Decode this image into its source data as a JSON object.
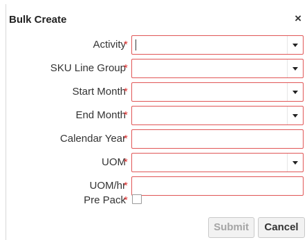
{
  "dialog": {
    "title": "Bulk Create",
    "close_label": "×"
  },
  "form": {
    "required_marker": "*",
    "fields": [
      {
        "label": "Activity",
        "type": "select",
        "value": ""
      },
      {
        "label": "SKU Line Group",
        "type": "select",
        "value": ""
      },
      {
        "label": "Start Month",
        "type": "select",
        "value": ""
      },
      {
        "label": "End Month",
        "type": "select",
        "value": ""
      },
      {
        "label": "Calendar Year",
        "type": "text",
        "value": ""
      },
      {
        "label": "UOM",
        "type": "select",
        "value": ""
      },
      {
        "label": "UOM/hr",
        "type": "text",
        "value": ""
      },
      {
        "label": "Pre Pack",
        "type": "checkbox",
        "checked": false
      }
    ]
  },
  "buttons": {
    "submit_label": "Submit",
    "cancel_label": "Cancel"
  },
  "colors": {
    "required": "#e03030",
    "invalid_border": "#e05555",
    "disabled_text": "#a5a5a5"
  }
}
